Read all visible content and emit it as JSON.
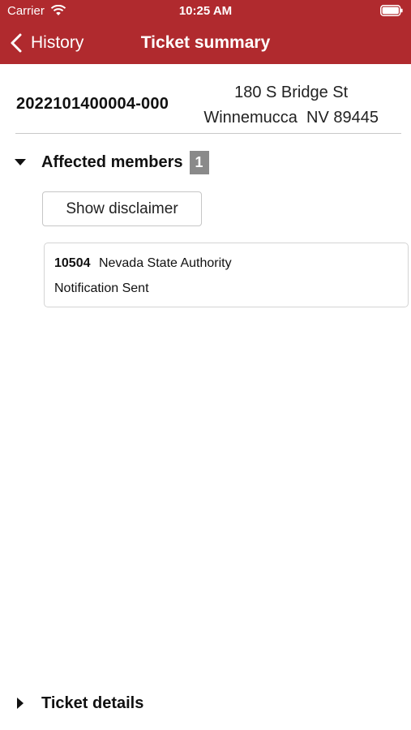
{
  "status_bar": {
    "carrier": "Carrier",
    "time": "10:25 AM",
    "wifi_icon": "wifi-icon",
    "battery_icon": "battery-icon"
  },
  "nav": {
    "back_label": "History",
    "back_icon": "chevron-left-icon",
    "title": "Ticket summary"
  },
  "ticket": {
    "number": "2022101400004-000",
    "address_line1": "180 S Bridge St",
    "address_line2": "Winnemucca  NV 89445"
  },
  "affected_members": {
    "title": "Affected members",
    "count": "1",
    "expanded": true,
    "disclaimer_button": "Show disclaimer",
    "members": [
      {
        "id": "10504",
        "name": "Nevada State Authority",
        "status": "Notification Sent"
      }
    ]
  },
  "ticket_details": {
    "title": "Ticket details",
    "expanded": false
  },
  "colors": {
    "header_bg": "#b02a2e",
    "badge_bg": "#8a8a8a"
  }
}
